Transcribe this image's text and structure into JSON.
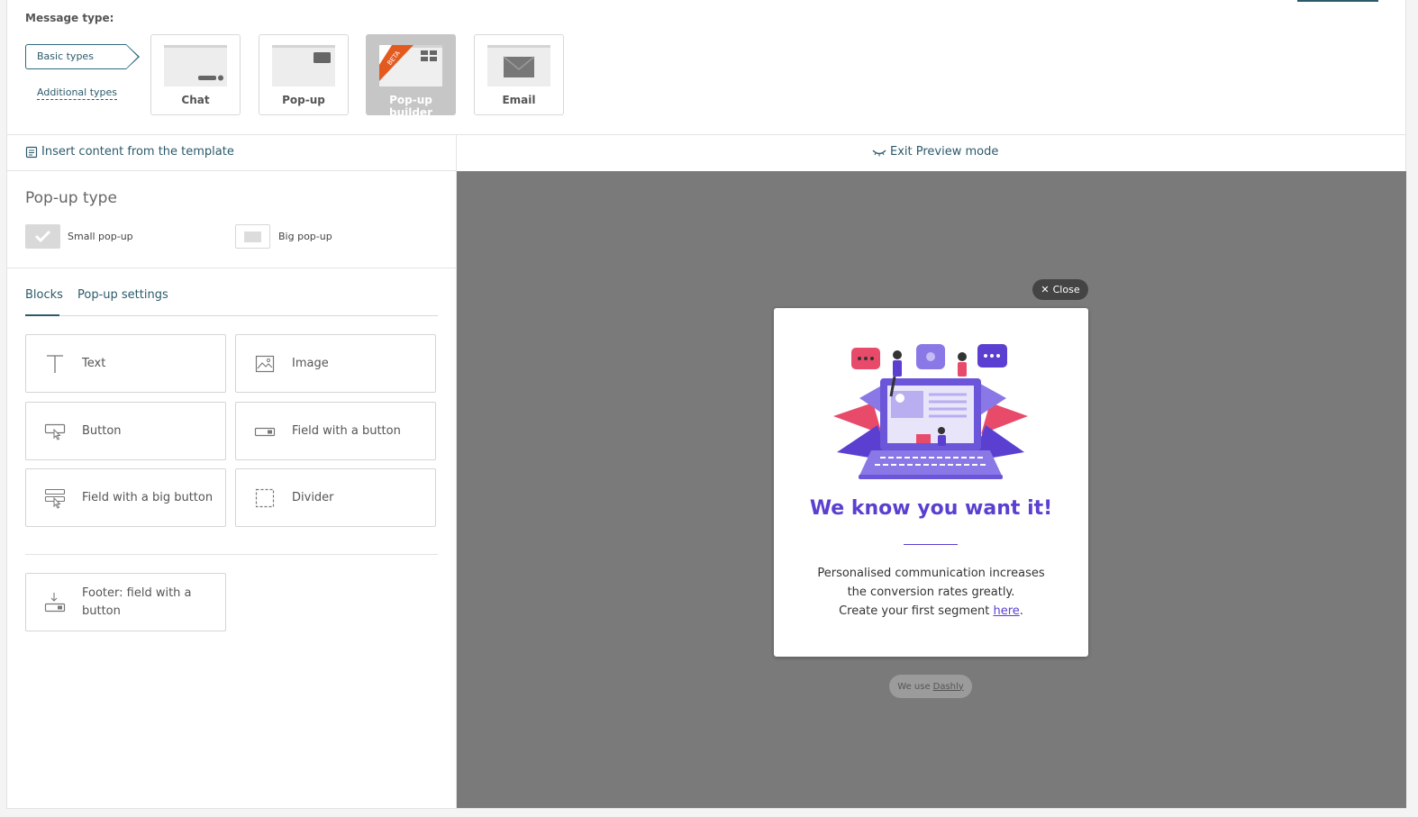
{
  "message_type": {
    "label": "Message type:",
    "basic_types": "Basic types",
    "additional_types": "Additional types",
    "types": [
      {
        "label": "Chat",
        "icon": "chat-thumb-icon"
      },
      {
        "label": "Pop-up",
        "icon": "popup-thumb-icon"
      },
      {
        "label": "Pop-up builder",
        "icon": "popup-builder-thumb-icon",
        "badge": "BETA",
        "active": true
      },
      {
        "label": "Email",
        "icon": "email-thumb-icon"
      }
    ]
  },
  "toolbar": {
    "insert_template": "Insert content from the template",
    "exit_preview": "Exit Preview mode"
  },
  "popup_type": {
    "title": "Pop-up type",
    "small": "Small pop-up",
    "big": "Big pop-up",
    "selected": "Small pop-up"
  },
  "tabs": {
    "blocks": "Blocks",
    "settings": "Pop-up settings"
  },
  "blocks": [
    {
      "label": "Text",
      "icon": "text-icon"
    },
    {
      "label": "Image",
      "icon": "image-icon"
    },
    {
      "label": "Button",
      "icon": "button-icon"
    },
    {
      "label": "Field with a button",
      "icon": "field-button-icon"
    },
    {
      "label": "Field with a big button",
      "icon": "field-big-button-icon"
    },
    {
      "label": "Divider",
      "icon": "divider-icon"
    }
  ],
  "footer_block": {
    "label": "Footer: field with a button",
    "icon": "footer-field-icon"
  },
  "popup": {
    "close": "Close",
    "title": "We know you want it!",
    "line1": "Personalised communication increases",
    "line2": "the conversion rates greatly.",
    "line3_pre": "Create your first segment ",
    "line3_link": "here",
    "line3_post": ".",
    "we_use": "We use",
    "brand": "Dashly"
  },
  "colors": {
    "accent": "#2c5a6b",
    "popup_title": "#5a3fd0",
    "preview_bg": "#7a7a7a",
    "beta_badge": "#e45a1e"
  }
}
